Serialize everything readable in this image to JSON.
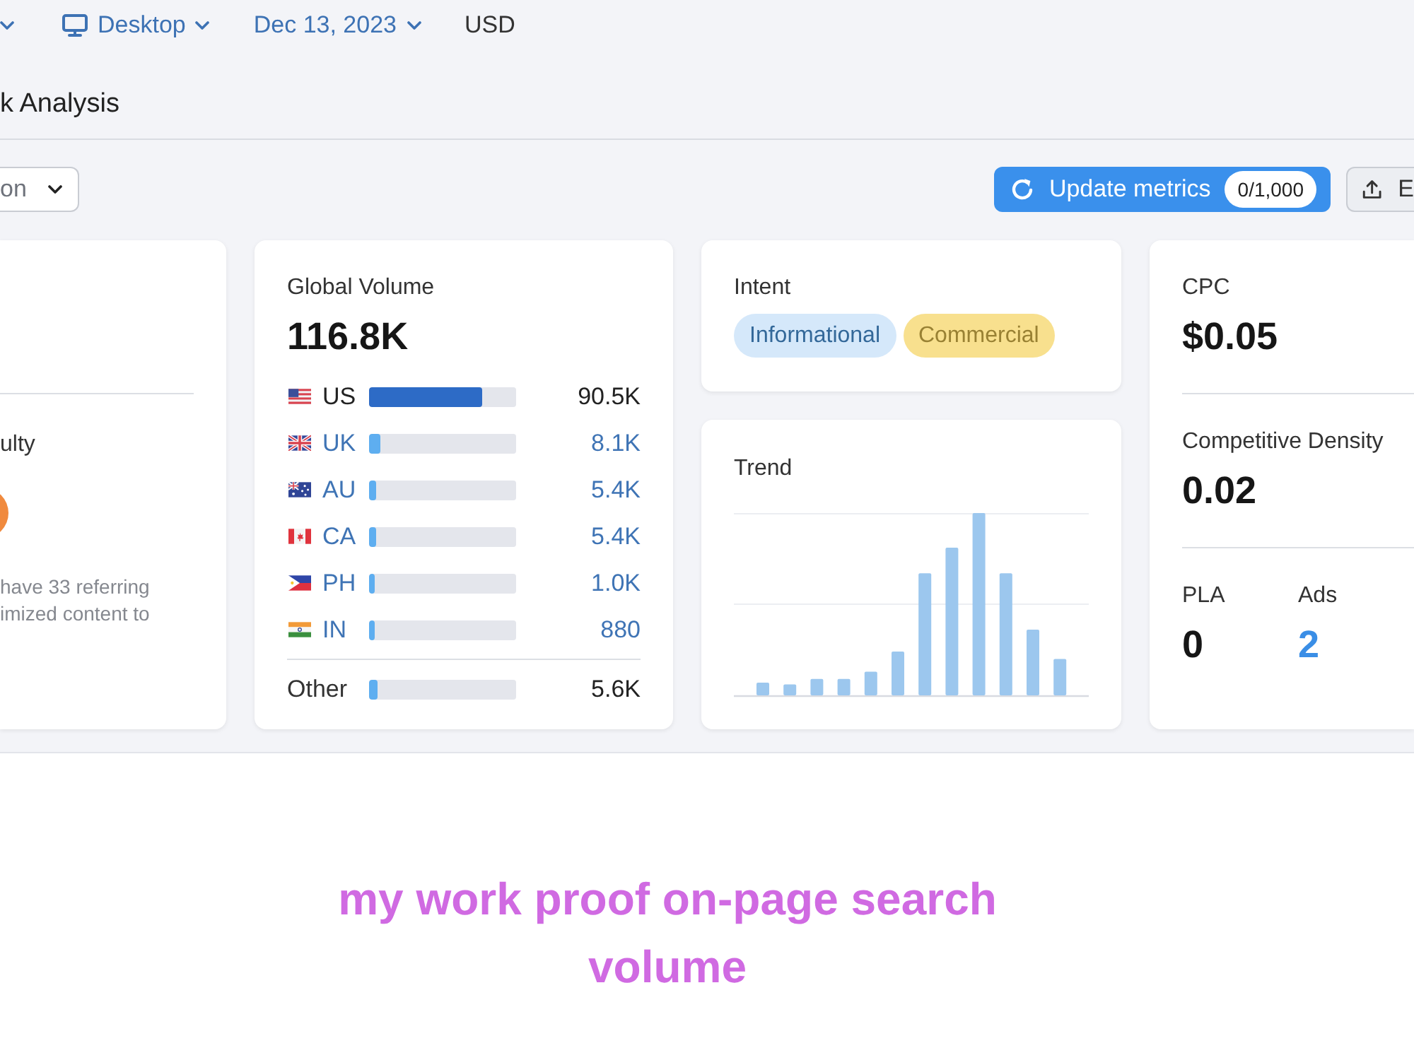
{
  "filters": [
    {
      "kind": "caret"
    },
    {
      "kind": "device",
      "label": "Desktop"
    },
    {
      "kind": "date",
      "label": "Dec 13, 2023"
    },
    {
      "kind": "currency",
      "label": "USD"
    }
  ],
  "page_title": "k Analysis",
  "toolbar": {
    "dropdown": {
      "value": "on"
    },
    "update_button": {
      "label": "Update metrics",
      "badge": "0/1,000"
    },
    "export_button": {
      "label": "E"
    }
  },
  "difficulty_card": {
    "title": "ulty",
    "description": [
      "have 33 referring",
      "imized content to"
    ]
  },
  "global_volume": {
    "label": "Global Volume",
    "value": "116.8K",
    "countries": [
      {
        "kind": "us",
        "code": "US",
        "level": 0.77,
        "value": "90.5K",
        "selected": true
      },
      {
        "kind": "uk",
        "code": "UK",
        "level": 0.08,
        "value": "8.1K",
        "selected": false
      },
      {
        "kind": "au",
        "code": "AU",
        "level": 0.05,
        "value": "5.4K",
        "selected": false
      },
      {
        "kind": "ca",
        "code": "CA",
        "level": 0.05,
        "value": "5.4K",
        "selected": false
      },
      {
        "kind": "ph",
        "code": "PH",
        "level": 0.04,
        "value": "1.0K",
        "selected": false
      },
      {
        "kind": "in",
        "code": "IN",
        "level": 0.04,
        "value": "880",
        "selected": false
      }
    ],
    "other": {
      "label": "Other",
      "level": 0.06,
      "value": "5.6K"
    }
  },
  "intent": {
    "label": "Intent",
    "tags": [
      {
        "label": "Informational",
        "color": "#d5e8fa"
      },
      {
        "label": "Commercial",
        "color": "#f8e08e"
      }
    ]
  },
  "trend": {
    "label": "Trend"
  },
  "metrics": {
    "cpc": {
      "label": "CPC",
      "value": "$0.05"
    },
    "competitive_density": {
      "label": "Competitive Density",
      "value": "0.02"
    },
    "stats": [
      {
        "label": "PLA",
        "value": "0",
        "link": false
      },
      {
        "label": "Ads",
        "value": "2",
        "link": true
      }
    ]
  },
  "caption": "my work proof on-page search volume"
}
